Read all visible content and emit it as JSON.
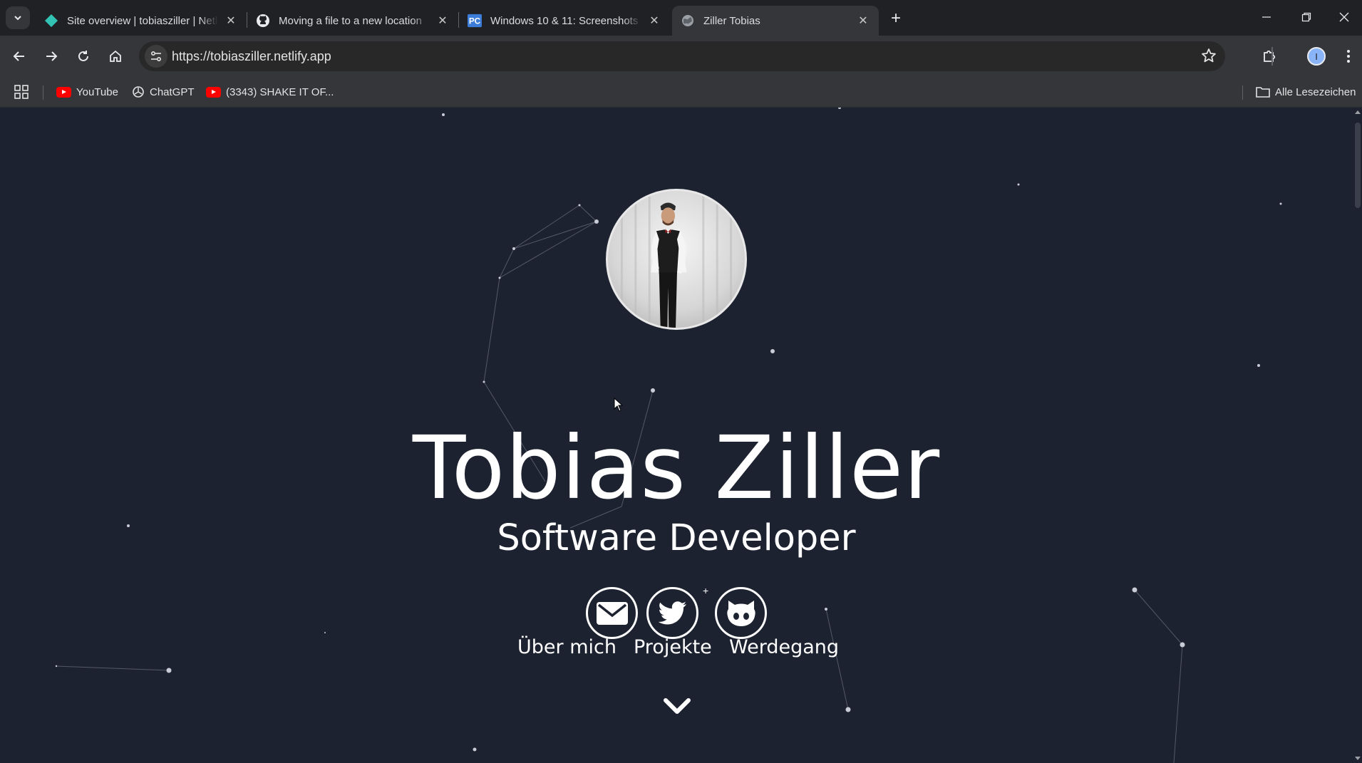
{
  "tabs": [
    {
      "title": "Site overview | tobiasziller | Netlify",
      "icon": "netlify-icon",
      "active": false
    },
    {
      "title": "Moving a file to a new location",
      "icon": "github-icon",
      "active": false
    },
    {
      "title": "Windows 10 & 11: Screenshots",
      "icon": "pc-icon",
      "active": false
    },
    {
      "title": "Ziller Tobias",
      "icon": "globe-icon",
      "active": true
    }
  ],
  "toolbar": {
    "url": "https://tobiasziller.netlify.app",
    "profile_initial": "I"
  },
  "bookmarks": {
    "items": [
      {
        "label": "YouTube",
        "icon": "youtube-icon"
      },
      {
        "label": "ChatGPT",
        "icon": "chatgpt-icon"
      },
      {
        "label": "(3343) SHAKE IT OF...",
        "icon": "youtube-icon"
      }
    ],
    "all_bookmarks_label": "Alle Lesezeichen"
  },
  "hero": {
    "name": "Tobias Ziller",
    "subtitle": "Software Developer",
    "social": [
      {
        "name": "email-icon"
      },
      {
        "name": "twitter-icon"
      },
      {
        "name": "github-icon"
      }
    ],
    "nav": [
      "Über mich",
      "Projekte",
      "Werdegang"
    ]
  },
  "colors": {
    "page_background": "#1d2230",
    "text": "#ffffff",
    "chrome_dark": "#202124",
    "chrome_toolbar": "#35363a",
    "netlify_teal": "#32c3b5",
    "youtube_red": "#ff0000"
  }
}
